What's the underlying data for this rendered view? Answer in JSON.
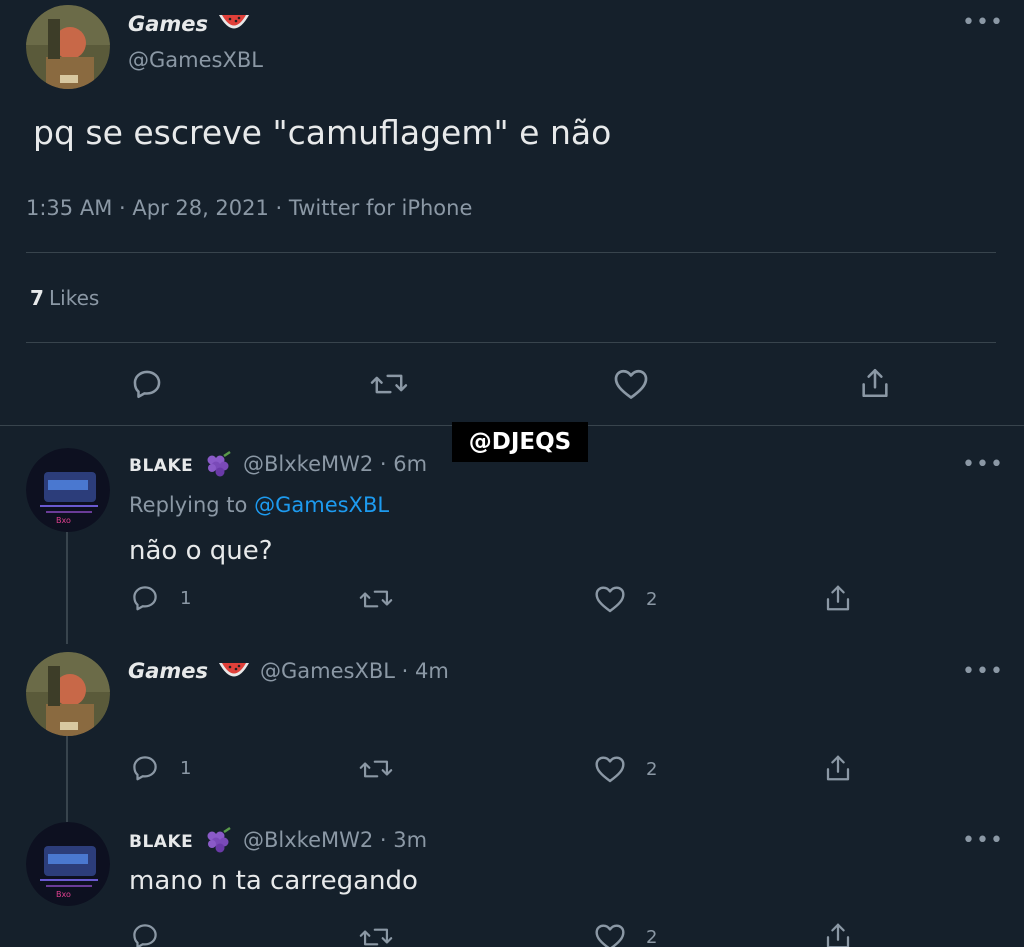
{
  "main_tweet": {
    "display_name": "Games",
    "handle": "@GamesXBL",
    "text": "pq se escreve \"camuflagem\" e não",
    "timestamp": "1:35 AM · Apr 28, 2021 · Twitter for iPhone",
    "likes_count": "7",
    "likes_label": "Likes"
  },
  "watermark": "@DJEQS",
  "replies": [
    {
      "display_name": "BLAKE",
      "handle_time": "@BlxkeMW2 · 6m",
      "replying_prefix": "Replying to",
      "replying_to": "@GamesXBL",
      "text": "não o que?",
      "reply_count": "1",
      "like_count": "2"
    },
    {
      "display_name": "Games",
      "handle_time": "@GamesXBL · 4m",
      "text": "",
      "reply_count": "1",
      "like_count": "2"
    },
    {
      "display_name": "BLAKE",
      "handle_time": "@BlxkeMW2 · 3m",
      "text": "mano n ta carregando",
      "reply_count": "",
      "like_count": "2"
    }
  ],
  "more_label": "•••",
  "icons": [
    "watermelon-icon",
    "grapes-icon",
    "reply-icon",
    "retweet-icon",
    "like-icon",
    "share-icon",
    "more-icon"
  ],
  "colors": {
    "background": "#15202b",
    "text": "#e7e9ea",
    "secondary": "#8b98a5",
    "link": "#1d9bf0",
    "divider": "#38444d"
  }
}
